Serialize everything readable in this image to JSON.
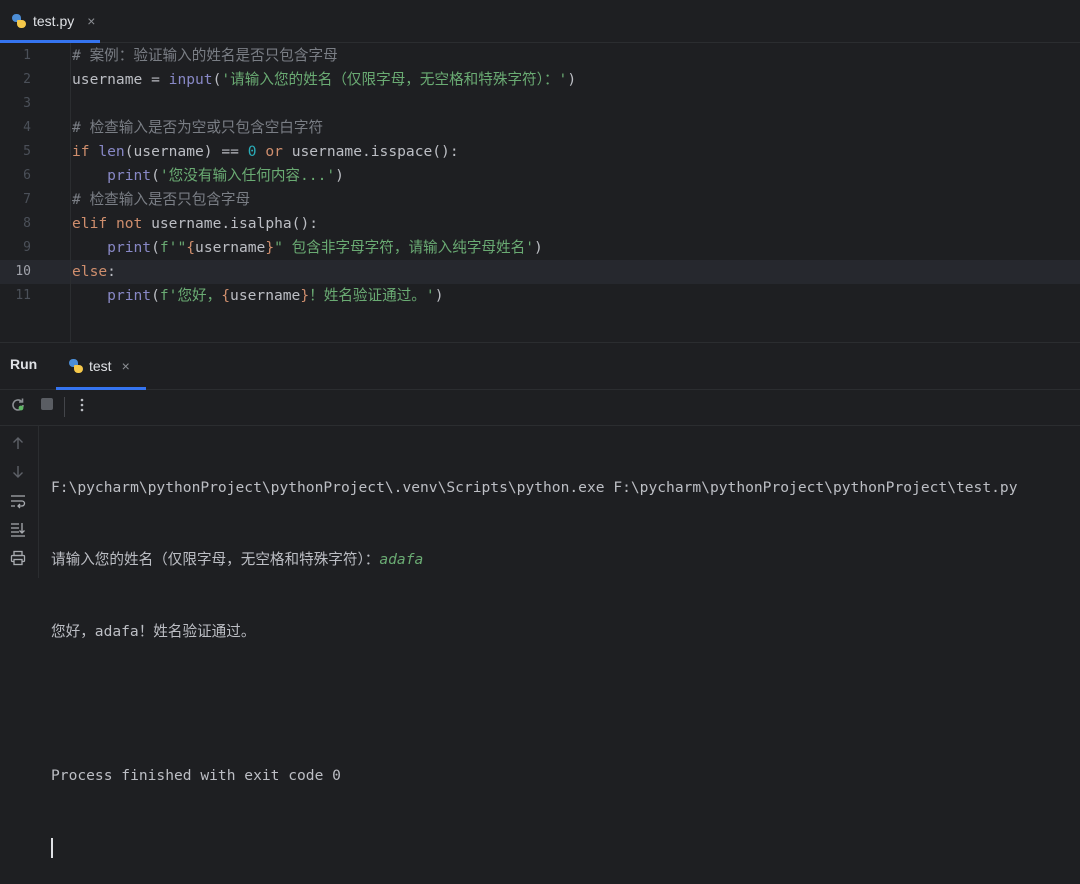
{
  "editor_tab": {
    "filename": "test.py",
    "close": "×"
  },
  "code_lines": [
    {
      "num": "1",
      "segments": [
        {
          "t": "# 案例：验证输入的姓名是否只包含字母",
          "c": "cm"
        }
      ]
    },
    {
      "num": "2",
      "segments": [
        {
          "t": "username = ",
          "c": "var"
        },
        {
          "t": "input",
          "c": "bi"
        },
        {
          "t": "(",
          "c": "var"
        },
        {
          "t": "'请输入您的姓名（仅限字母，无空格和特殊字符）：'",
          "c": "str"
        },
        {
          "t": ")",
          "c": "var"
        }
      ]
    },
    {
      "num": "3",
      "segments": []
    },
    {
      "num": "4",
      "segments": [
        {
          "t": "# 检查输入是否为空或只包含空白字符",
          "c": "cm"
        }
      ]
    },
    {
      "num": "5",
      "segments": [
        {
          "t": "if ",
          "c": "kw"
        },
        {
          "t": "len",
          "c": "bi"
        },
        {
          "t": "(username) == ",
          "c": "var"
        },
        {
          "t": "0",
          "c": "num"
        },
        {
          "t": " or ",
          "c": "kw"
        },
        {
          "t": "username.isspace():",
          "c": "var"
        }
      ]
    },
    {
      "num": "6",
      "segments": [
        {
          "t": "    ",
          "c": "var"
        },
        {
          "t": "print",
          "c": "bi"
        },
        {
          "t": "(",
          "c": "var"
        },
        {
          "t": "'您没有输入任何内容...'",
          "c": "str"
        },
        {
          "t": ")",
          "c": "var"
        }
      ]
    },
    {
      "num": "7",
      "segments": [
        {
          "t": "# 检查输入是否只包含字母",
          "c": "cm"
        }
      ]
    },
    {
      "num": "8",
      "segments": [
        {
          "t": "elif ",
          "c": "kw"
        },
        {
          "t": "not ",
          "c": "kw"
        },
        {
          "t": "username.isalpha():",
          "c": "var"
        }
      ]
    },
    {
      "num": "9",
      "segments": [
        {
          "t": "    ",
          "c": "var"
        },
        {
          "t": "print",
          "c": "bi"
        },
        {
          "t": "(",
          "c": "var"
        },
        {
          "t": "f'\"",
          "c": "str"
        },
        {
          "t": "{",
          "c": "brace"
        },
        {
          "t": "username",
          "c": "var"
        },
        {
          "t": "}",
          "c": "brace"
        },
        {
          "t": "\" 包含非字母字符，请输入纯字母姓名'",
          "c": "str"
        },
        {
          "t": ")",
          "c": "var"
        }
      ]
    },
    {
      "num": "10",
      "segments": [
        {
          "t": "else",
          "c": "kw"
        },
        {
          "t": ":",
          "c": "var"
        }
      ]
    },
    {
      "num": "11",
      "segments": [
        {
          "t": "    ",
          "c": "var"
        },
        {
          "t": "print",
          "c": "bi"
        },
        {
          "t": "(",
          "c": "var"
        },
        {
          "t": "f'您好，",
          "c": "str"
        },
        {
          "t": "{",
          "c": "brace"
        },
        {
          "t": "username",
          "c": "var"
        },
        {
          "t": "}",
          "c": "brace"
        },
        {
          "t": "！姓名验证通过。'",
          "c": "str"
        },
        {
          "t": ")",
          "c": "var"
        }
      ]
    }
  ],
  "current_line": "10",
  "run_panel": {
    "title": "Run",
    "tab_label": "test",
    "tab_close": "×"
  },
  "console": {
    "command": "F:\\pycharm\\pythonProject\\pythonProject\\.venv\\Scripts\\python.exe F:\\pycharm\\pythonProject\\pythonProject\\test.py",
    "prompt": "请输入您的姓名（仅限字母，无空格和特殊字符）：",
    "user_input": "adafa",
    "output": "您好，adafa！姓名验证通过。",
    "exit_message": "Process finished with exit code 0"
  },
  "icons": {
    "rerun": "rerun-icon",
    "stop": "stop-icon",
    "more": "more-icon",
    "up": "arrow-up-icon",
    "down": "arrow-down-icon",
    "wrap": "soft-wrap-icon",
    "scroll_end": "scroll-to-end-icon",
    "print": "print-icon"
  },
  "colors": {
    "keyword": "#cf8e6d",
    "string": "#6aab73",
    "comment": "#7a7e85",
    "builtin": "#8888c6",
    "number": "#2aacb8",
    "accent": "#3574f0"
  }
}
